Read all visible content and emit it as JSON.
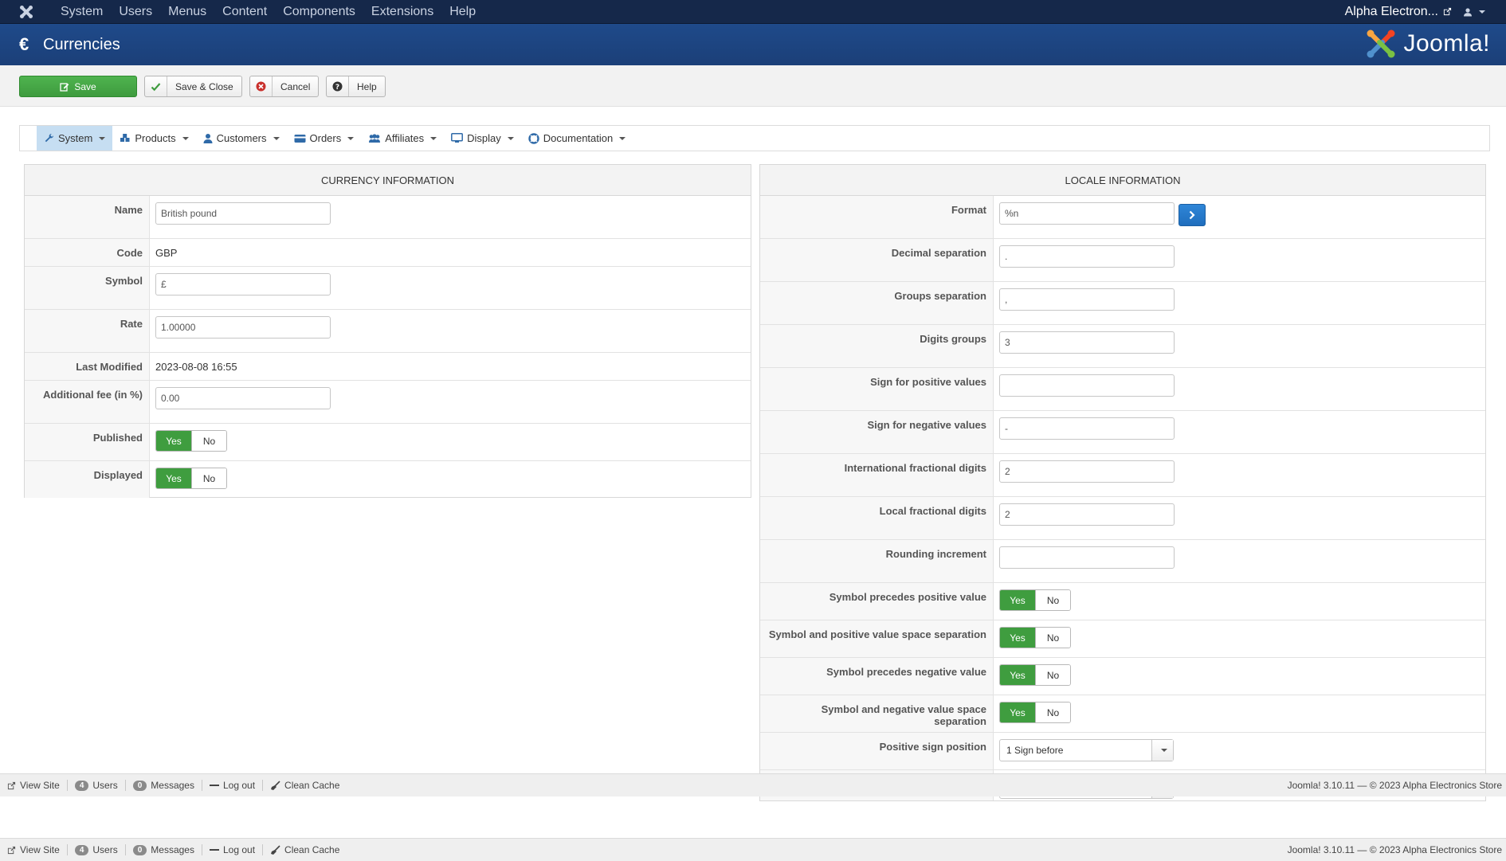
{
  "topnav": {
    "menu": [
      "System",
      "Users",
      "Menus",
      "Content",
      "Components",
      "Extensions",
      "Help"
    ],
    "site_name": "Alpha Electron..."
  },
  "header": {
    "title": "Currencies",
    "brand": "Joomla!"
  },
  "toolbar": {
    "save": "Save",
    "save_close": "Save & Close",
    "cancel": "Cancel",
    "help": "Help"
  },
  "component_menu": [
    "System",
    "Products",
    "Customers",
    "Orders",
    "Affiliates",
    "Display",
    "Documentation"
  ],
  "currency": {
    "heading": "CURRENCY INFORMATION",
    "name_label": "Name",
    "name_value": "British pound",
    "code_label": "Code",
    "code_value": "GBP",
    "symbol_label": "Symbol",
    "symbol_value": "£",
    "rate_label": "Rate",
    "rate_value": "1.00000",
    "modified_label": "Last Modified",
    "modified_value": "2023-08-08 16:55",
    "fee_label": "Additional fee (in %)",
    "fee_value": "0.00",
    "published_label": "Published",
    "displayed_label": "Displayed"
  },
  "toggle": {
    "yes": "Yes",
    "no": "No"
  },
  "locale": {
    "heading": "LOCALE INFORMATION",
    "format_label": "Format",
    "format_value": "%n",
    "decimal_label": "Decimal separation",
    "decimal_value": ".",
    "groups_label": "Groups separation",
    "groups_value": ",",
    "digits_label": "Digits groups",
    "digits_value": "3",
    "pos_sign_label": "Sign for positive values",
    "pos_sign_value": "",
    "neg_sign_label": "Sign for negative values",
    "neg_sign_value": "-",
    "intl_frac_label": "International fractional digits",
    "intl_frac_value": "2",
    "local_frac_label": "Local fractional digits",
    "local_frac_value": "2",
    "rounding_label": "Rounding increment",
    "rounding_value": "",
    "sym_pre_pos_label": "Symbol precedes positive value",
    "sym_sp_pos_label": "Symbol and positive value space separation",
    "sym_pre_neg_label": "Symbol precedes negative value",
    "sym_sp_neg_label": "Symbol and negative value space separation",
    "pos_pos_label": "Positive sign position",
    "pos_pos_value": "1 Sign before"
  },
  "status": {
    "view_site": "View Site",
    "users_count": "4",
    "users": "Users",
    "messages_count": "0",
    "messages": "Messages",
    "logout": "Log out",
    "clean_cache": "Clean Cache",
    "version": "Joomla! 3.10.11  —  © 2023 Alpha Electronics Store"
  },
  "colors": {
    "topnav": "#15284a",
    "header": "#1f4a8a",
    "save": "#3e9b3e",
    "toggle_yes": "#3f9d3f",
    "go": "#2f86d8"
  }
}
